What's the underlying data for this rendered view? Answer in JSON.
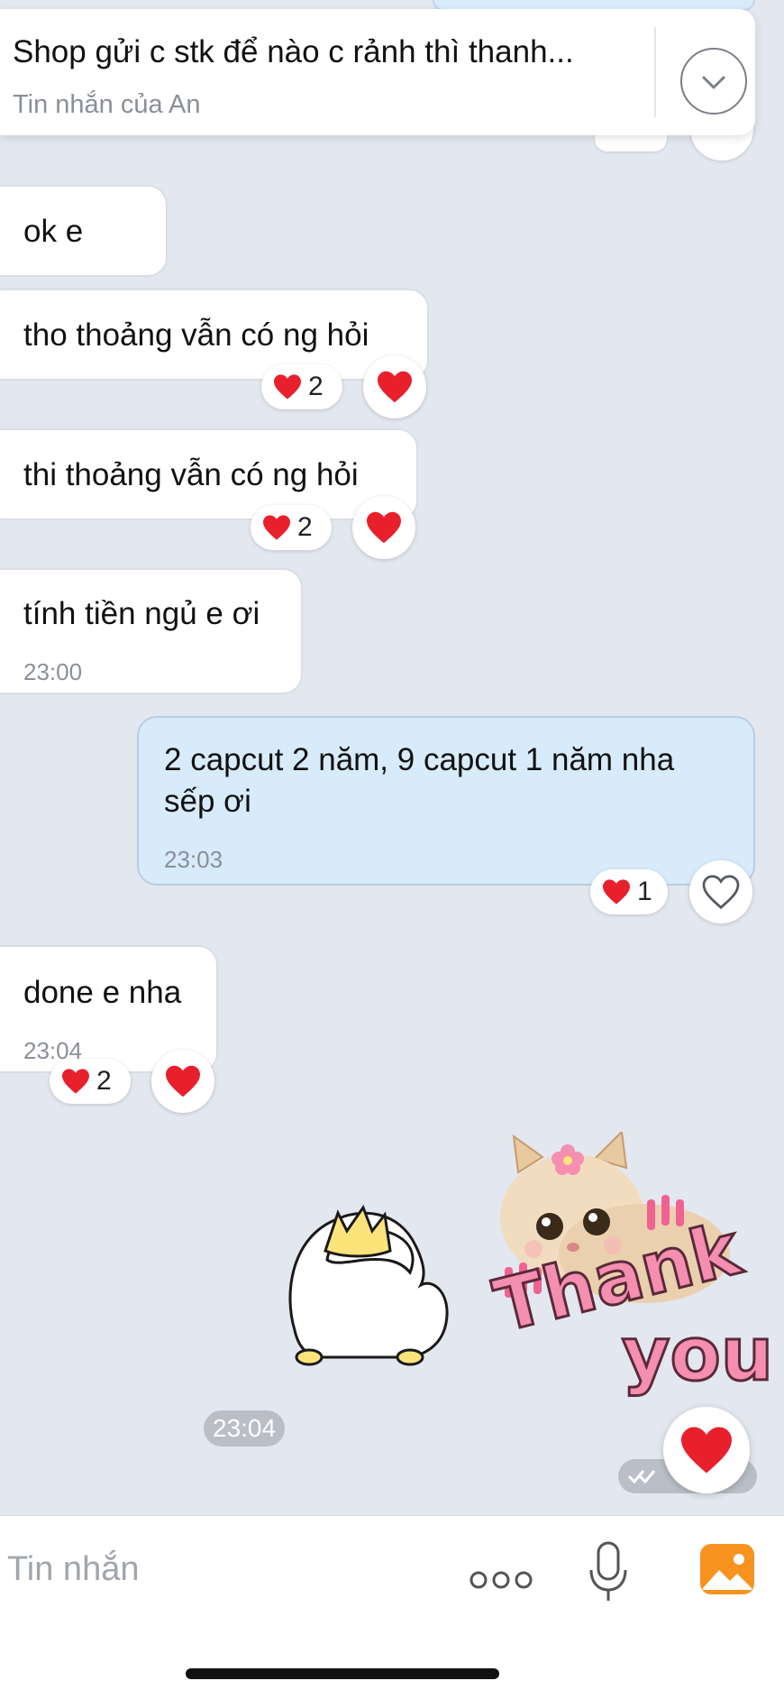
{
  "pinned": {
    "text": "Shop gửi c stk để nào c rảnh thì thanh...",
    "subtitle": "Tin nhắn của An",
    "expand_icon": "chevron-down-icon"
  },
  "messages": [
    {
      "text": "ok e"
    },
    {
      "text": "tho thoảng vẫn có ng hỏi",
      "reactions": "2"
    },
    {
      "text": "thi thoảng vẫn có ng hỏi",
      "reactions": "2"
    },
    {
      "text": "tính tiền ngủ e ơi",
      "time": "23:00"
    },
    {
      "text": "2 capcut 2 năm, 9 capcut 1 năm nha sếp ơi",
      "time": "23:03",
      "reactions": "1"
    },
    {
      "text": "done e nha",
      "time": "23:04",
      "reactions": "2"
    }
  ],
  "stickers": {
    "duck": "sticker-duck-crown",
    "cat_text": [
      "Thank",
      "you"
    ],
    "time": "23:04"
  },
  "colors": {
    "background": "#e3e7ef",
    "sent_bubble": "#d7ebfa",
    "heart": "#e8202c",
    "gallery_orange": "#f7931e"
  },
  "composer": {
    "placeholder": "Tin nhắn",
    "more_icon": "more-dots-icon",
    "mic_icon": "microphone-icon",
    "gallery_icon": "gallery-icon"
  }
}
